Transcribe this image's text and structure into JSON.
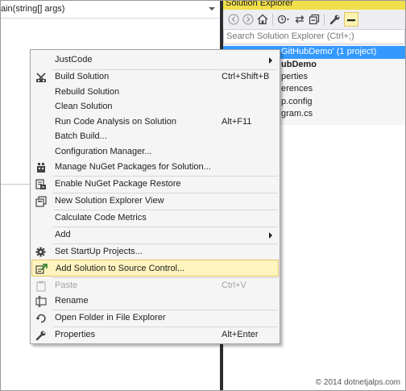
{
  "editor": {
    "member_dropdown": "ain(string[] args)"
  },
  "solution_explorer": {
    "title": "Solution Explorer",
    "search_placeholder": "Search Solution Explorer (Ctrl+;)",
    "tree": [
      {
        "label": "GitHubDemo' (1 project)",
        "selected": true,
        "bold": false
      },
      {
        "label": "ubDemo",
        "selected": false,
        "bold": true
      },
      {
        "label": "perties",
        "selected": false,
        "bold": false
      },
      {
        "label": "erences",
        "selected": false,
        "bold": false
      },
      {
        "label": "p.config",
        "selected": false,
        "bold": false
      },
      {
        "label": "gram.cs",
        "selected": false,
        "bold": false
      }
    ],
    "toolbar_icons": [
      "back-icon",
      "forward-icon",
      "home-icon",
      "sync-icon",
      "pending-changes-icon",
      "collapse-all-icon",
      "properties-wrench-icon",
      "preview-icon"
    ]
  },
  "context_menu": {
    "items": [
      {
        "label": "JustCode",
        "shortcut": "",
        "icon": "",
        "submenu": true,
        "disabled": false,
        "highlighted": false
      },
      {
        "label": "Build Solution",
        "shortcut": "Ctrl+Shift+B",
        "icon": "build-icon",
        "submenu": false,
        "disabled": false,
        "highlighted": false
      },
      {
        "label": "Rebuild Solution",
        "shortcut": "",
        "icon": "",
        "submenu": false,
        "disabled": false,
        "highlighted": false
      },
      {
        "label": "Clean Solution",
        "shortcut": "",
        "icon": "",
        "submenu": false,
        "disabled": false,
        "highlighted": false
      },
      {
        "label": "Run Code Analysis on Solution",
        "shortcut": "Alt+F11",
        "icon": "",
        "submenu": false,
        "disabled": false,
        "highlighted": false
      },
      {
        "label": "Batch Build...",
        "shortcut": "",
        "icon": "",
        "submenu": false,
        "disabled": false,
        "highlighted": false
      },
      {
        "label": "Configuration Manager...",
        "shortcut": "",
        "icon": "",
        "submenu": false,
        "disabled": false,
        "highlighted": false
      },
      {
        "label": "Manage NuGet Packages for Solution...",
        "shortcut": "",
        "icon": "nuget-icon",
        "submenu": false,
        "disabled": false,
        "highlighted": false
      },
      {
        "label": "Enable NuGet Package Restore",
        "shortcut": "",
        "icon": "package-restore-icon",
        "submenu": false,
        "disabled": false,
        "highlighted": false
      },
      {
        "label": "New Solution Explorer View",
        "shortcut": "",
        "icon": "new-view-icon",
        "submenu": false,
        "disabled": false,
        "highlighted": false
      },
      {
        "label": "Calculate Code Metrics",
        "shortcut": "",
        "icon": "",
        "submenu": false,
        "disabled": false,
        "highlighted": false
      },
      {
        "label": "Add",
        "shortcut": "",
        "icon": "",
        "submenu": true,
        "disabled": false,
        "highlighted": false
      },
      {
        "label": "Set StartUp Projects...",
        "shortcut": "",
        "icon": "gear-icon",
        "submenu": false,
        "disabled": false,
        "highlighted": false
      },
      {
        "label": "Add Solution to Source Control...",
        "shortcut": "",
        "icon": "source-control-icon",
        "submenu": false,
        "disabled": false,
        "highlighted": true
      },
      {
        "label": "Paste",
        "shortcut": "Ctrl+V",
        "icon": "paste-icon",
        "submenu": false,
        "disabled": true,
        "highlighted": false
      },
      {
        "label": "Rename",
        "shortcut": "",
        "icon": "rename-icon",
        "submenu": false,
        "disabled": false,
        "highlighted": false
      },
      {
        "label": "Open Folder in File Explorer",
        "shortcut": "",
        "icon": "open-folder-icon",
        "submenu": false,
        "disabled": false,
        "highlighted": false
      },
      {
        "label": "Properties",
        "shortcut": "Alt+Enter",
        "icon": "wrench-icon",
        "submenu": false,
        "disabled": false,
        "highlighted": false
      }
    ]
  },
  "watermark": "© 2014 dotnetjalps.com",
  "colors": {
    "highlight_bg": "#fdf4bf",
    "highlight_border": "#e5c365",
    "selection_blue": "#3399ff",
    "title_yellow": "#f0df4a",
    "splitter_dark": "#2d2d30"
  }
}
